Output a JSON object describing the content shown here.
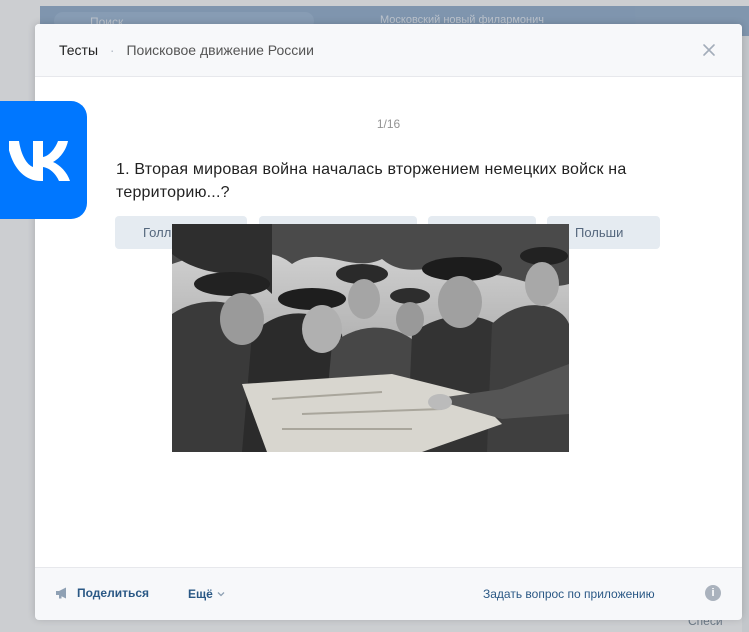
{
  "background": {
    "search_placeholder": "Поиск",
    "player_track": "Московский новый филармонич",
    "side_text": "Спеси"
  },
  "modal": {
    "breadcrumb_title": "Тесты",
    "breadcrumb_separator": "·",
    "breadcrumb_subtitle": "Поисковое движение России",
    "counter": "1/16",
    "question": "1. Вторая мировая война началась вторжением немецких войск на территорию...?",
    "answers": [
      "Голл",
      "",
      "",
      "Польши"
    ]
  },
  "footer": {
    "share_label": "Поделиться",
    "more_label": "Ещё",
    "ask_label": "Задать вопрос по приложению",
    "info_glyph": "i"
  },
  "colors": {
    "vk_blue": "#0077ff",
    "link": "#2a5885",
    "answer_bg": "#e5ebf1"
  },
  "icons": [
    "vk-logo-icon",
    "close-icon",
    "megaphone-icon",
    "chevron-down-icon",
    "info-icon"
  ]
}
